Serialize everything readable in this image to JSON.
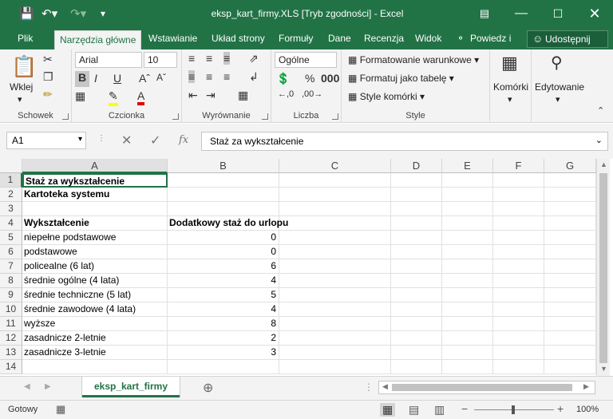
{
  "window": {
    "title": "eksp_kart_firmy.XLS  [Tryb zgodności] - Excel"
  },
  "tabs": [
    "Plik",
    "Narzędzia główne",
    "Wstawianie",
    "Układ strony",
    "Formuły",
    "Dane",
    "Recenzja",
    "Widok"
  ],
  "tell_me": "Powiedz i",
  "share": "Udostępnij",
  "ribbon": {
    "paste": "Wklej",
    "clipboard": "Schowek",
    "font_name": "Arial",
    "font_size": "10",
    "bold": "B",
    "italic": "I",
    "underline": "U",
    "font_group": "Czcionka",
    "align_group": "Wyrównanie",
    "number_format": "Ogólne",
    "number_group": "Liczba",
    "cond_format": "Formatowanie warunkowe",
    "format_table": "Formatuj jako tabelę",
    "cell_styles": "Style komórki",
    "style_group": "Style",
    "cells": "Komórki",
    "editing": "Edytowanie"
  },
  "formula_bar": {
    "name_box": "A1",
    "fx": "fx",
    "content": "Staż za wykształcenie"
  },
  "columns": [
    "A",
    "B",
    "C",
    "D",
    "E",
    "F",
    "G"
  ],
  "rows": [
    {
      "n": "1",
      "a": "Staż za wykształcenie",
      "b": ""
    },
    {
      "n": "2",
      "a": "Kartoteka systemu",
      "b": ""
    },
    {
      "n": "3",
      "a": "",
      "b": ""
    },
    {
      "n": "4",
      "a": "Wykształcenie",
      "b": "Dodatkowy staż do urlopu"
    },
    {
      "n": "5",
      "a": "niepełne podstawowe",
      "b": "0"
    },
    {
      "n": "6",
      "a": "podstawowe",
      "b": "0"
    },
    {
      "n": "7",
      "a": "policealne (6 lat)",
      "b": "6"
    },
    {
      "n": "8",
      "a": "średnie ogólne (4 lata)",
      "b": "4"
    },
    {
      "n": "9",
      "a": "średnie techniczne (5 lat)",
      "b": "5"
    },
    {
      "n": "10",
      "a": "średnie zawodowe (4 lata)",
      "b": "4"
    },
    {
      "n": "11",
      "a": "wyższe",
      "b": "8"
    },
    {
      "n": "12",
      "a": "zasadnicze 2-letnie",
      "b": "2"
    },
    {
      "n": "13",
      "a": "zasadnicze 3-letnie",
      "b": "3"
    },
    {
      "n": "14",
      "a": "",
      "b": ""
    }
  ],
  "sheet_tab": "eksp_kart_firmy",
  "status": {
    "ready": "Gotowy",
    "zoom": "100%"
  }
}
